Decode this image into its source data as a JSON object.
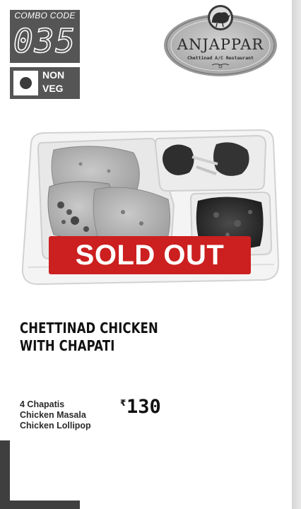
{
  "combo": {
    "label": "COMBO CODE",
    "code": "035"
  },
  "diet": {
    "line1": "NON",
    "line2": "VEG"
  },
  "logo": {
    "brand": "ANJAPPAR",
    "tagline": "Chettinad A/C Restaurant"
  },
  "status": {
    "sold_out_label": "SOLD OUT"
  },
  "product": {
    "title_line1": "CHETTINAD CHICKEN",
    "title_line2": "WITH CHAPATI",
    "items": [
      "4 Chapatis",
      "Chicken Masala",
      "Chicken Lollipop"
    ],
    "currency_symbol": "₹",
    "price": "130"
  },
  "colors": {
    "sold_out_bg": "#cc1f1f",
    "badge_bg": "#555555"
  }
}
